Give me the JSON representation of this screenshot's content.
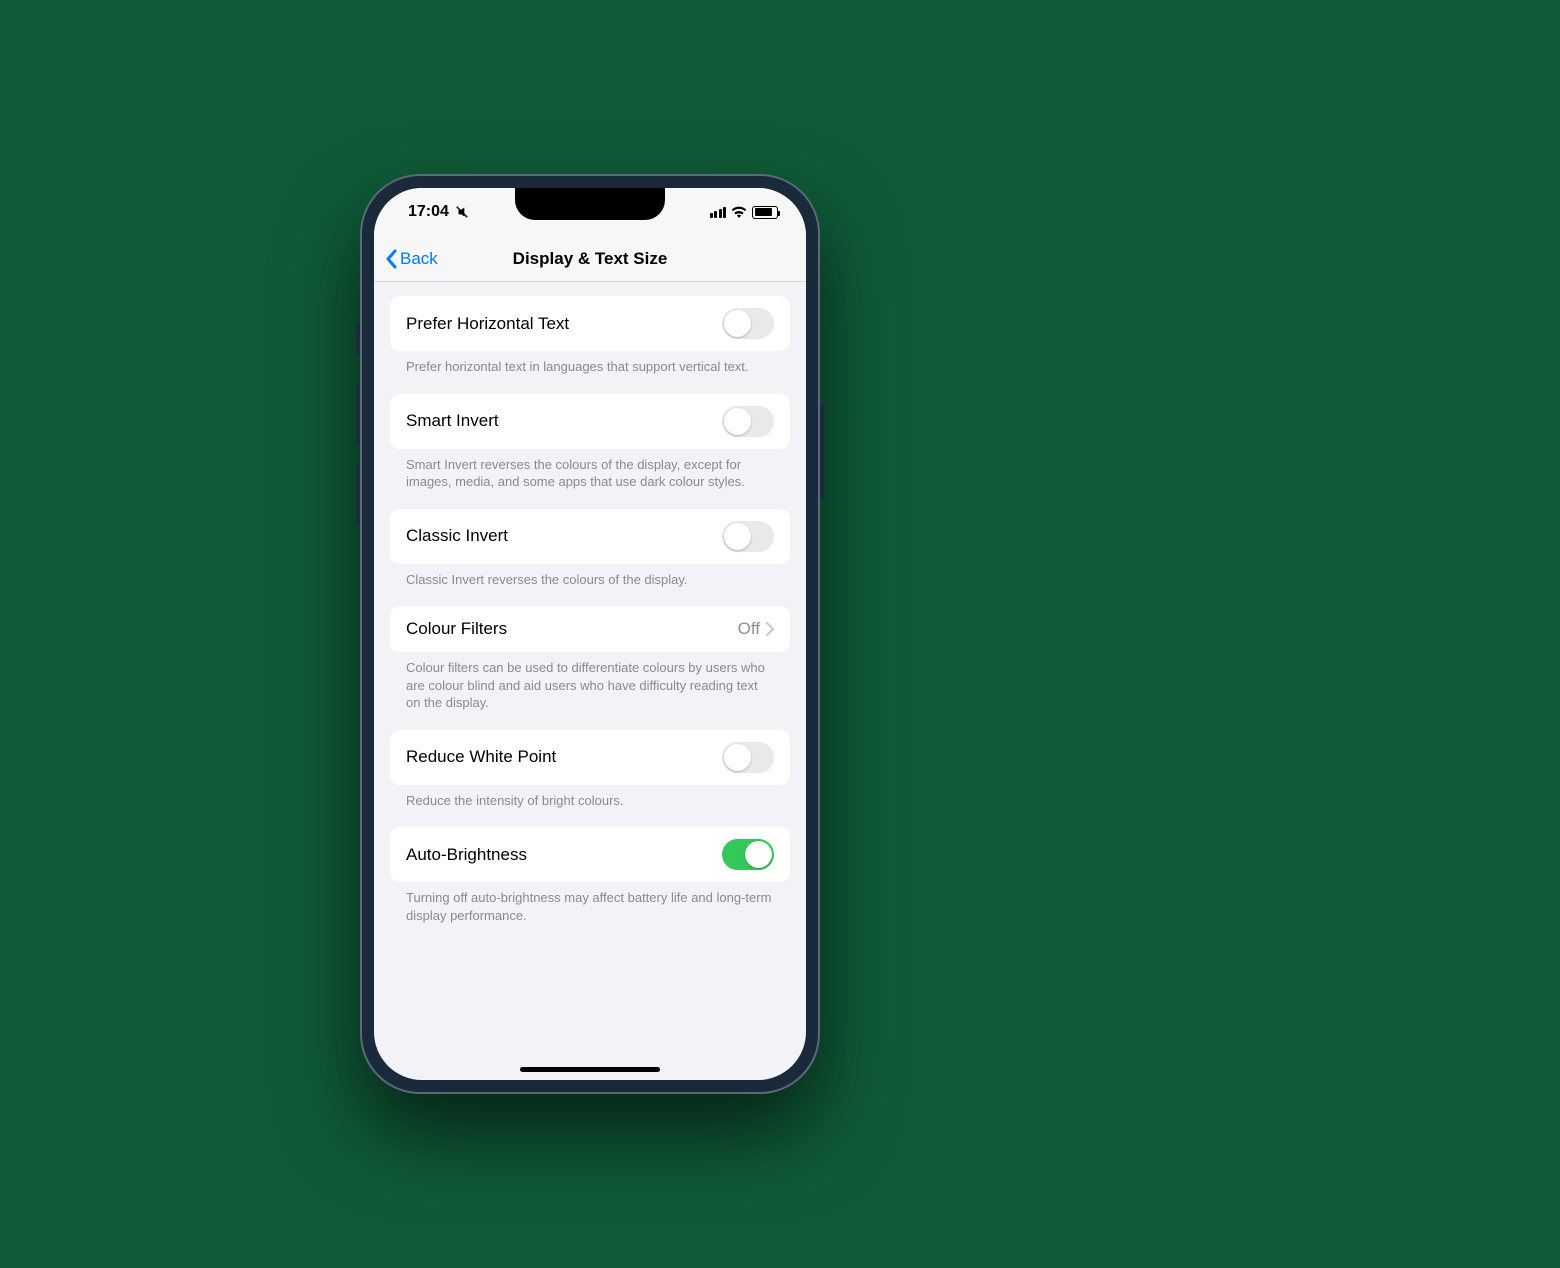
{
  "status": {
    "time": "17:04"
  },
  "nav": {
    "back": "Back",
    "title": "Display & Text Size"
  },
  "groups": [
    {
      "cell": {
        "label": "Prefer Horizontal Text",
        "type": "switch",
        "on": false
      },
      "footer": "Prefer horizontal text in languages that support vertical text."
    },
    {
      "cell": {
        "label": "Smart Invert",
        "type": "switch",
        "on": false
      },
      "footer": "Smart Invert reverses the colours of the display, except for images, media, and some apps that use dark colour styles."
    },
    {
      "cell": {
        "label": "Classic Invert",
        "type": "switch",
        "on": false
      },
      "footer": "Classic Invert reverses the colours of the display."
    },
    {
      "cell": {
        "label": "Colour Filters",
        "type": "link",
        "value": "Off"
      },
      "footer": "Colour filters can be used to differentiate colours by users who are colour blind and aid users who have difficulty reading text on the display."
    },
    {
      "cell": {
        "label": "Reduce White Point",
        "type": "switch",
        "on": false
      },
      "footer": "Reduce the intensity of bright colours."
    },
    {
      "cell": {
        "label": "Auto-Brightness",
        "type": "switch",
        "on": true
      },
      "footer": "Turning off auto-brightness may affect battery life and long-term display performance."
    }
  ]
}
